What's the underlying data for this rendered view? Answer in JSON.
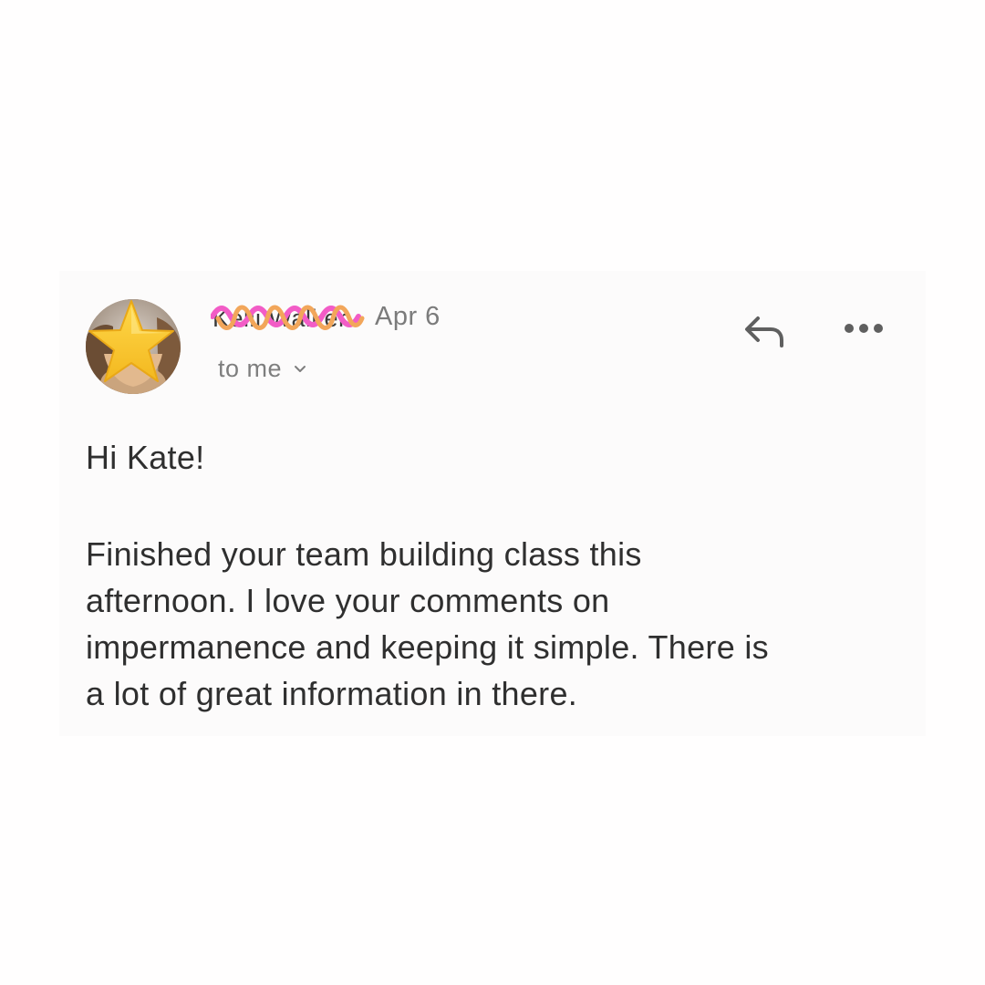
{
  "email": {
    "sender_name": "Kelli Walker",
    "date": "Apr 6",
    "recipient": "to me",
    "greeting": "Hi Kate!",
    "body": "Finished your team building class this\nafternoon. I love your comments on\nimpermanence and keeping it simple. There is\na lot of great  information in there."
  },
  "icons": {
    "reply": "reply-arrow-icon",
    "more": "more-horizontal-icon",
    "expand": "chevron-down-icon",
    "avatar_cover": "star-icon"
  },
  "colors": {
    "background": "#fffefe",
    "card": "#fcfbfb",
    "text_primary": "#2f2f2f",
    "text_secondary": "#7b7b7b",
    "icon": "#5f5f5f",
    "star_fill": "#f7c52f",
    "redact_pink": "#f25cc6",
    "redact_orange": "#f2a65a"
  }
}
